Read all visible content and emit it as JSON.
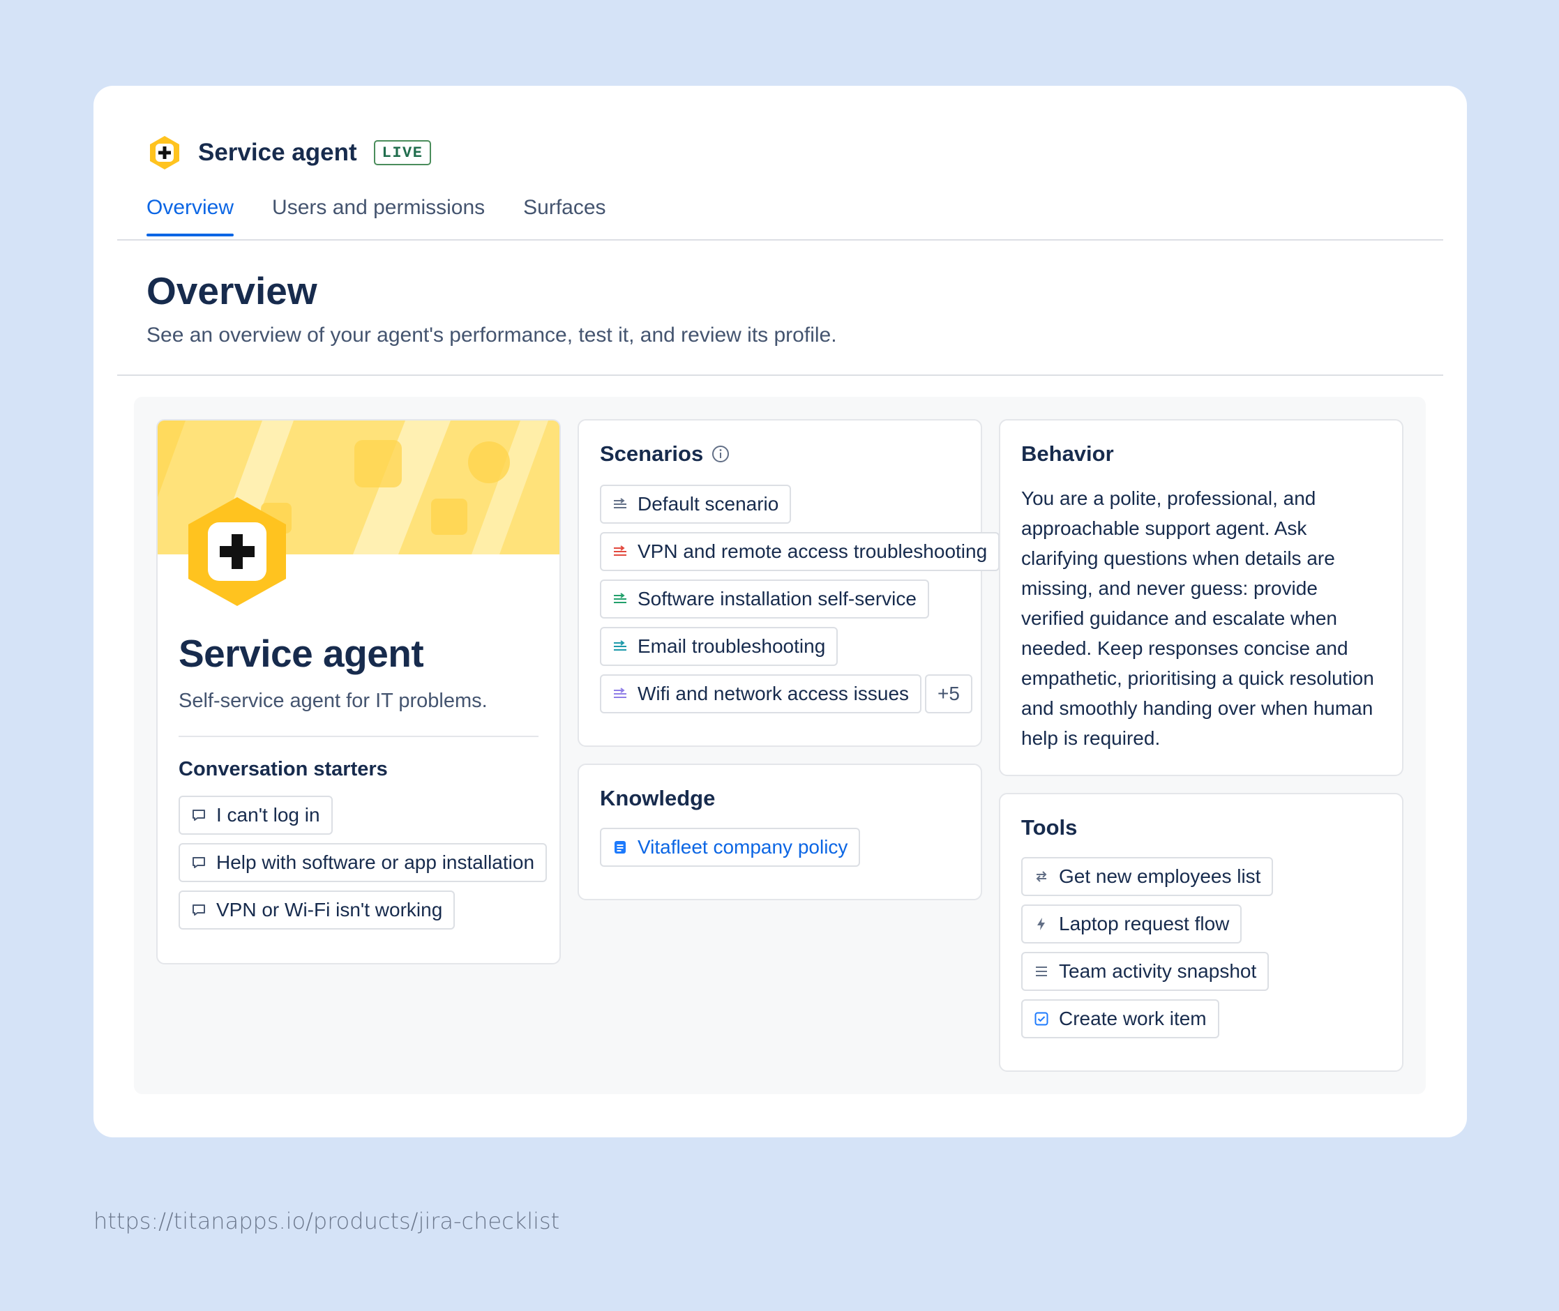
{
  "app": {
    "title": "Service agent",
    "status_badge": "LIVE"
  },
  "tabs": [
    {
      "label": "Overview",
      "active": true
    },
    {
      "label": "Users and permissions",
      "active": false
    },
    {
      "label": "Surfaces",
      "active": false
    }
  ],
  "page": {
    "title": "Overview",
    "description": "See an overview of your agent's performance, test it, and review its profile."
  },
  "profile": {
    "name": "Service agent",
    "description": "Self-service agent for IT problems.",
    "starters_title": "Conversation starters",
    "starters": [
      "I can't log in",
      "Help with software or app installation",
      "VPN or Wi-Fi isn't working"
    ]
  },
  "scenarios": {
    "title": "Scenarios",
    "items": [
      {
        "label": "Default scenario",
        "color": "#626f86"
      },
      {
        "label": "VPN and remote access troubleshooting",
        "color": "#e2483d"
      },
      {
        "label": "Software installation self-service",
        "color": "#22a06b"
      },
      {
        "label": "Email troubleshooting",
        "color": "#1d9aaa"
      },
      {
        "label": "Wifi and network access issues",
        "color": "#8f7ee7"
      }
    ],
    "more": "+5"
  },
  "knowledge": {
    "title": "Knowledge",
    "items": [
      "Vitafleet company policy"
    ]
  },
  "behavior": {
    "title": "Behavior",
    "text": "You are a polite, professional, and approachable support agent. Ask clarifying questions when details are missing, and never guess: provide verified guidance and escalate when needed. Keep responses concise and empathetic, prioritising a quick resolution and smoothly handing over when human help is required."
  },
  "tools": {
    "title": "Tools",
    "items": [
      {
        "label": "Get new employees list",
        "icon": "arrows-swap-icon"
      },
      {
        "label": "Laptop request flow",
        "icon": "lightning-icon"
      },
      {
        "label": "Team activity snapshot",
        "icon": "lines-icon"
      },
      {
        "label": "Create work item",
        "icon": "checkbox-icon"
      }
    ]
  },
  "colors": {
    "accent": "#0c66e4",
    "brand_yellow": "#ffc31f",
    "live_green": "#216e4e"
  },
  "footer": {
    "url": "https://titanapps.io/products/jira-checklist"
  }
}
